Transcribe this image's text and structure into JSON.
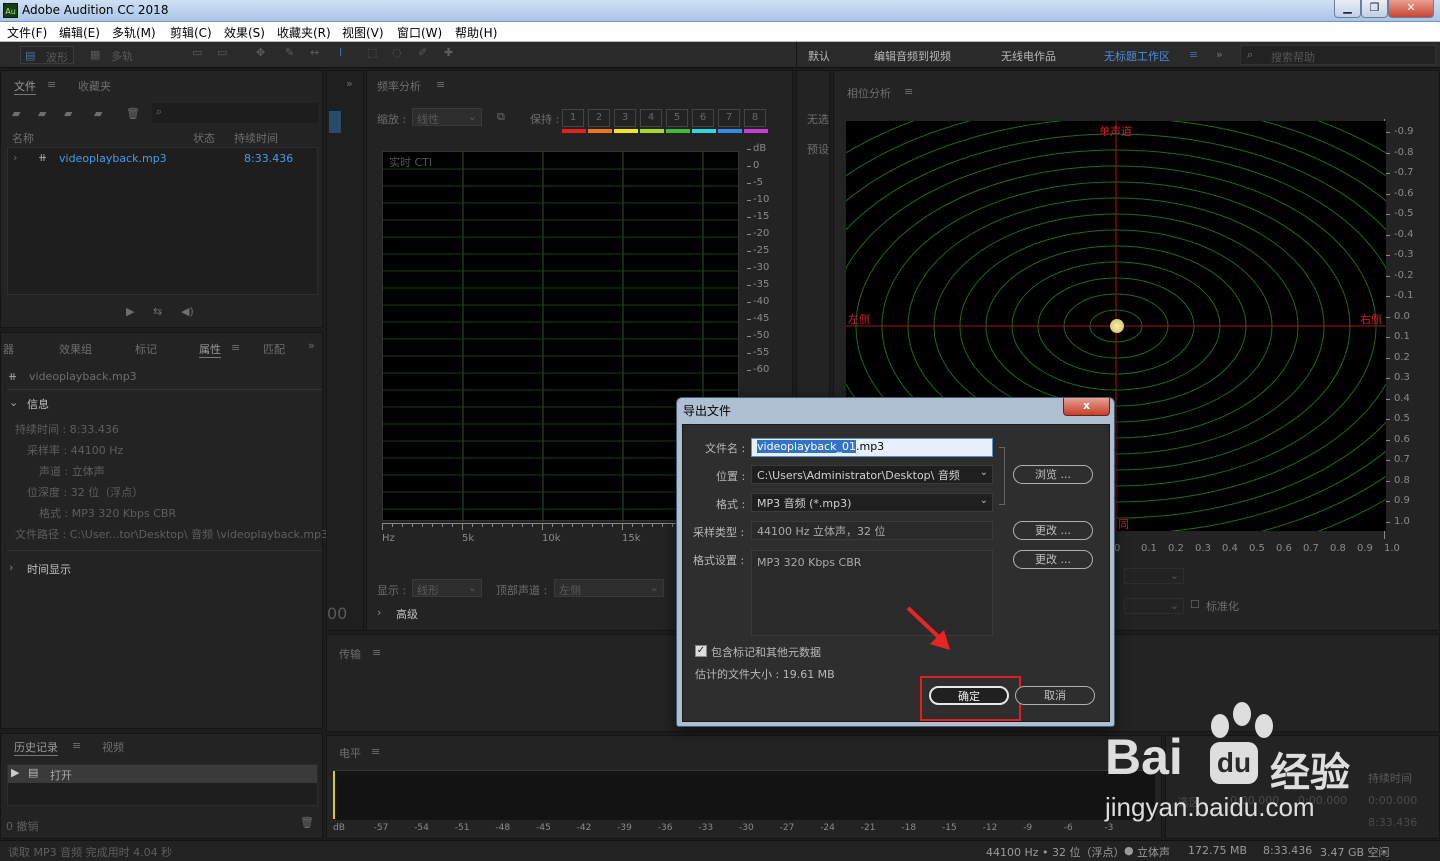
{
  "app": {
    "title": "Adobe Audition CC 2018",
    "icon_text": "Au"
  },
  "menu": [
    "文件(F)",
    "编辑(E)",
    "多轨(M)",
    "剪辑(C)",
    "效果(S)",
    "收藏夹(R)",
    "视图(V)",
    "窗口(W)",
    "帮助(H)"
  ],
  "toolbar": {
    "waveform": "波形",
    "multitrack": "多轨",
    "workspaces": [
      "默认",
      "编辑音频到视频",
      "无线电作品",
      "无标题工作区"
    ],
    "search_placeholder": "搜索帮助"
  },
  "files": {
    "tab_files": "文件",
    "tab_favorites": "收藏夹",
    "col_name": "名称",
    "col_status": "状态",
    "col_duration": "持续时间",
    "file_name": "videoplayback.mp3",
    "file_duration": "8:33.436"
  },
  "props": {
    "tabs": [
      "器",
      "效果组",
      "标记",
      "属性",
      "匹配"
    ],
    "file_name": "videoplayback.mp3",
    "info_header": "信息",
    "rows": [
      "持续时间 : 8:33.436",
      "采样率 : 44100 Hz",
      "声道 : 立体声",
      "位深度 : 32 位（浮点）",
      "格式 : MP3 320 Kbps CBR",
      "文件路径 : C:\\User...tor\\Desktop\\ 音频 \\videoplayback.mp3"
    ],
    "time_display": "时间显示"
  },
  "history": {
    "tab_history": "历史记录",
    "tab_video": "视频",
    "item": "打开",
    "undo": "0 撤销"
  },
  "freq": {
    "title": "频率分析",
    "zoom_label": "缩放 :",
    "zoom_value": "线性",
    "hold_label": "保持 :",
    "holds": [
      {
        "n": "1",
        "color": "#e5201f"
      },
      {
        "n": "2",
        "color": "#ec7a1c"
      },
      {
        "n": "3",
        "color": "#f1e32a"
      },
      {
        "n": "4",
        "color": "#a8d927"
      },
      {
        "n": "5",
        "color": "#3fbd3a"
      },
      {
        "n": "6",
        "color": "#2ed5e3"
      },
      {
        "n": "7",
        "color": "#2f8fe6"
      },
      {
        "n": "8",
        "color": "#c93bd6"
      }
    ],
    "cti": "实时 CTI",
    "db_labels": [
      "dB",
      "0",
      "-5",
      "-10",
      "-15",
      "-20",
      "-25",
      "-30",
      "-35",
      "-40",
      "-45",
      "-50",
      "-55",
      "-60"
    ],
    "hz_labels": [
      "Hz",
      "5k",
      "10k",
      "15k"
    ],
    "display_label": "显示 :",
    "display_value": "线形",
    "channel_label": "顶部声道 :",
    "channel_value": "左侧",
    "advanced": "高级"
  },
  "side": {
    "items": [
      "无选",
      "预设"
    ]
  },
  "phase": {
    "title": "相位分析",
    "mono": "单声道",
    "left": "左侧",
    "right": "右侧",
    "bottom": "同",
    "right_scale": [
      "-0.9",
      "-0.8",
      "-0.7",
      "-0.6",
      "-0.5",
      "-0.4",
      "-0.3",
      "-0.2",
      "-0.1",
      "0.0",
      "0.1",
      "0.2",
      "0.3",
      "0.4",
      "0.5",
      "0.6",
      "0.7",
      "0.8",
      "0.9",
      "1.0"
    ],
    "bottom_scale": [
      "0",
      "0.1",
      "0.2",
      "0.3",
      "0.4",
      "0.5",
      "0.6",
      "0.7",
      "0.8",
      "0.9",
      "1.0"
    ],
    "normalize": "标准化"
  },
  "transport": {
    "title": "传输"
  },
  "level": {
    "title": "电平",
    "scale": [
      "dB",
      "-57",
      "-54",
      "-51",
      "-48",
      "-45",
      "-42",
      "-39",
      "-36",
      "-33",
      "-30",
      "-27",
      "-24",
      "-21",
      "-18",
      "-15",
      "-12",
      "-9",
      "-6",
      "-3"
    ]
  },
  "selection": {
    "title": "持续时间",
    "col_select": "选区",
    "v1": "0:00.000",
    "v2": "0:00.000",
    "v3": "0:00.000",
    "v4": "8:33.436"
  },
  "status": {
    "left": "读取 MP3 音频 完成用时 4.04 秒",
    "sample": "44100 Hz • 32 位（浮点）",
    "channel": "立体声",
    "size": "172.75 MB",
    "duration": "8:33.436",
    "free": "3.47 GB 空闲"
  },
  "dialog": {
    "title": "导出文件",
    "close": "x",
    "filename_label": "文件名 :",
    "filename_selected": "videoplayback_01",
    "filename_rest": ".mp3",
    "location_label": "位置 :",
    "location_value": "C:\\Users\\Administrator\\Desktop\\ 音频",
    "format_label": "格式 :",
    "format_value": "MP3 音频 (*.mp3)",
    "browse": "浏览 ...",
    "sample_label": "采样类型 :",
    "sample_value": "44100 Hz 立体声，32 位",
    "change": "更改 ...",
    "settings_label": "格式设置 :",
    "settings_value": "MP3 320 Kbps CBR",
    "metadata": "包含标记和其他元数据",
    "estimate": "估计的文件大小 : 19.61 MB",
    "ok": "确定",
    "cancel": "取消"
  },
  "watermark": {
    "brand": "Bai",
    "brand2": "du",
    "cn": "经验",
    "url": "jingyan.baidu.com"
  }
}
